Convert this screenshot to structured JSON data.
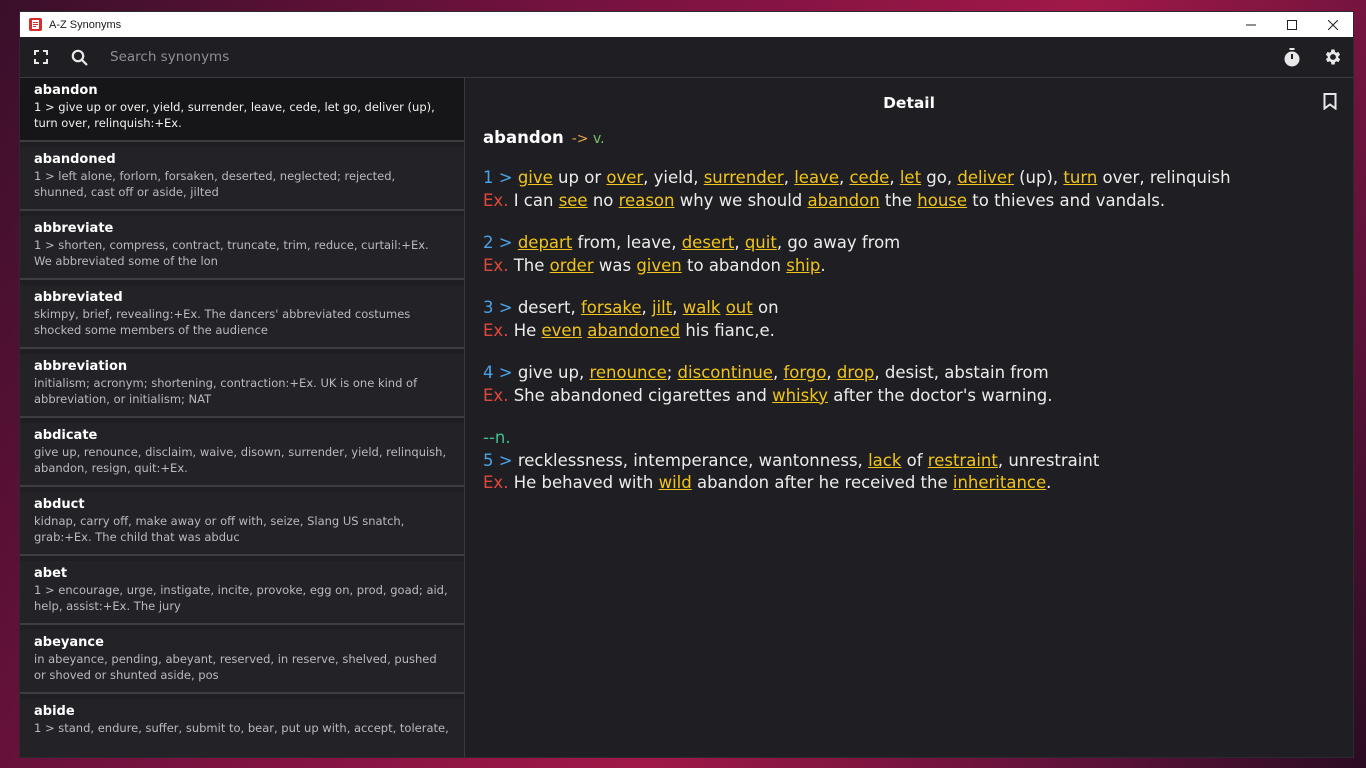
{
  "window": {
    "title": "A-Z Synonyms"
  },
  "toolbar": {
    "search_placeholder": "Search synonyms"
  },
  "icons": {
    "fullscreen": "fullscreen-icon",
    "search": "search-icon",
    "timer": "timer-icon",
    "settings": "gear-icon",
    "bookmark": "bookmark-icon"
  },
  "colors": {
    "number": "#4aa3e6",
    "example": "#e0483c",
    "link": "#f0c419",
    "pos": "#e0a94a",
    "noun": "#3fbf8f"
  },
  "list": [
    {
      "word": "abandon",
      "def": "1 > give up or over, yield, surrender, leave, cede, let go, deliver (up), turn over, relinquish:+Ex."
    },
    {
      "word": "abandoned",
      "def": "1 > left alone, forlorn, forsaken, deserted, neglected; rejected, shunned, cast off or aside, jilted"
    },
    {
      "word": "abbreviate",
      "def": "1 > shorten, compress, contract, truncate, trim, reduce, curtail:+Ex. We abbreviated some of the lon"
    },
    {
      "word": "abbreviated",
      "def": "skimpy, brief, revealing:+Ex. The dancers' abbreviated costumes shocked some members of the audience"
    },
    {
      "word": "abbreviation",
      "def": "initialism; acronym; shortening, contraction:+Ex. UK is one kind of abbreviation, or initialism; NAT"
    },
    {
      "word": "abdicate",
      "def": "give up, renounce, disclaim, waive, disown, surrender, yield, relinquish, abandon, resign, quit:+Ex."
    },
    {
      "word": "abduct",
      "def": "kidnap, carry off, make away or off with, seize, Slang US snatch, grab:+Ex. The child that was abduc"
    },
    {
      "word": "abet",
      "def": "1 > encourage, urge, instigate, incite, provoke, egg on, prod, goad; aid, help, assist:+Ex. The jury"
    },
    {
      "word": "abeyance",
      "def": "in abeyance, pending, abeyant, reserved, in reserve, shelved, pushed or shoved or shunted aside, pos"
    },
    {
      "word": "abide",
      "def": "1 > stand, endure, suffer, submit to, bear, put up with, accept, tolerate,"
    }
  ],
  "detail": {
    "title": "Detail",
    "headword": "abandon",
    "pos_arrow": "->",
    "pos": "v.",
    "noun_tag": "--n.",
    "ex_label": "Ex.",
    "senses": [
      {
        "num": "1 >",
        "def": [
          [
            "give",
            1
          ],
          [
            " up or ",
            0
          ],
          [
            "over",
            1
          ],
          [
            ", yield, ",
            0
          ],
          [
            "surrender",
            1
          ],
          [
            ", ",
            0
          ],
          [
            "leave",
            1
          ],
          [
            ", ",
            0
          ],
          [
            "cede",
            1
          ],
          [
            ", ",
            0
          ],
          [
            "let",
            1
          ],
          [
            " go, ",
            0
          ],
          [
            "deliver",
            1
          ],
          [
            " (up), ",
            0
          ],
          [
            "turn",
            1
          ],
          [
            " over, relinquish",
            0
          ]
        ],
        "ex": [
          [
            "I can ",
            0
          ],
          [
            "see",
            1
          ],
          [
            " no ",
            0
          ],
          [
            "reason",
            1
          ],
          [
            " why we should ",
            0
          ],
          [
            "abandon",
            1
          ],
          [
            " the ",
            0
          ],
          [
            "house",
            1
          ],
          [
            " to thieves and vandals.",
            0
          ]
        ]
      },
      {
        "num": "2 >",
        "def": [
          [
            "depart",
            1
          ],
          [
            " from, leave, ",
            0
          ],
          [
            "desert",
            1
          ],
          [
            ", ",
            0
          ],
          [
            "quit",
            1
          ],
          [
            ", go away from",
            0
          ]
        ],
        "ex": [
          [
            "The ",
            0
          ],
          [
            "order",
            1
          ],
          [
            " was ",
            0
          ],
          [
            "given",
            1
          ],
          [
            " to abandon ",
            0
          ],
          [
            "ship",
            1
          ],
          [
            ".",
            0
          ]
        ]
      },
      {
        "num": "3 >",
        "def": [
          [
            "desert, ",
            0
          ],
          [
            "forsake",
            1
          ],
          [
            ", ",
            0
          ],
          [
            "jilt",
            1
          ],
          [
            ", ",
            0
          ],
          [
            "walk",
            1
          ],
          [
            " ",
            0
          ],
          [
            "out",
            1
          ],
          [
            " on",
            0
          ]
        ],
        "ex": [
          [
            "He ",
            0
          ],
          [
            "even",
            1
          ],
          [
            " ",
            0
          ],
          [
            "abandoned",
            1
          ],
          [
            " his fianc,e.",
            0
          ]
        ]
      },
      {
        "num": "4 >",
        "def": [
          [
            "give up, ",
            0
          ],
          [
            "renounce",
            1
          ],
          [
            "; ",
            0
          ],
          [
            "discontinue",
            1
          ],
          [
            ", ",
            0
          ],
          [
            "forgo",
            1
          ],
          [
            ", ",
            0
          ],
          [
            "drop",
            1
          ],
          [
            ", desist, abstain from",
            0
          ]
        ],
        "ex": [
          [
            "She abandoned cigarettes and ",
            0
          ],
          [
            "whisky",
            1
          ],
          [
            " after the doctor's warning.",
            0
          ]
        ]
      },
      {
        "num": "5 >",
        "noun": true,
        "def": [
          [
            "recklessness, intemperance, wantonness, ",
            0
          ],
          [
            "lack",
            1
          ],
          [
            " of ",
            0
          ],
          [
            "restraint",
            1
          ],
          [
            ", unrestraint",
            0
          ]
        ],
        "ex": [
          [
            "He behaved with ",
            0
          ],
          [
            "wild",
            1
          ],
          [
            " abandon after he received the ",
            0
          ],
          [
            "inheritance",
            1
          ],
          [
            ".",
            0
          ]
        ]
      }
    ]
  }
}
